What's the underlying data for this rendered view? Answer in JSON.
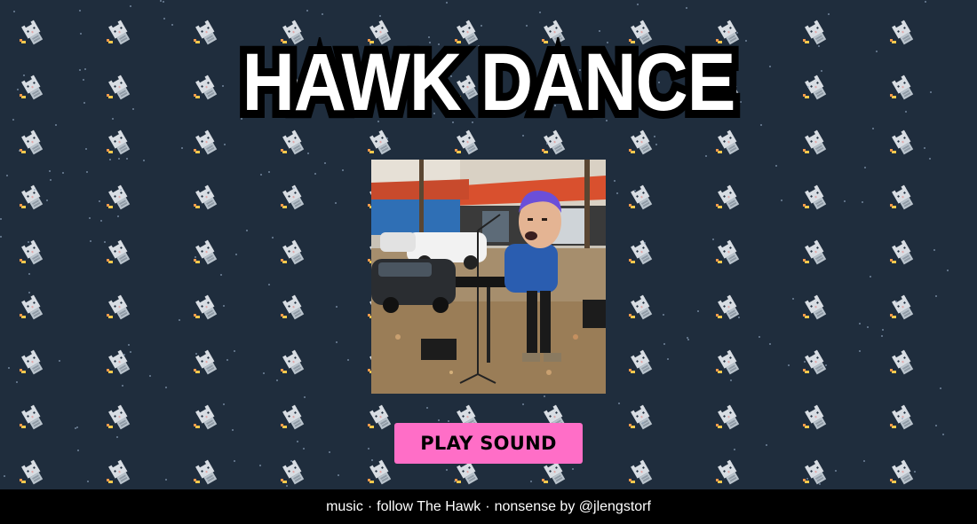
{
  "page": {
    "title": "HAWK DANCE",
    "background_color": "#1f2d3d",
    "background_icon": "cat-icon"
  },
  "video": {
    "icon": "dancing-keyboardist-animation"
  },
  "actions": {
    "play_sound_label": "PLAY SOUND",
    "play_sound_color": "#ff6ec7"
  },
  "footer": {
    "link_music": "music",
    "separator": "·",
    "link_follow": "follow The Hawk",
    "link_credit": "nonsense by @jlengstorf"
  }
}
